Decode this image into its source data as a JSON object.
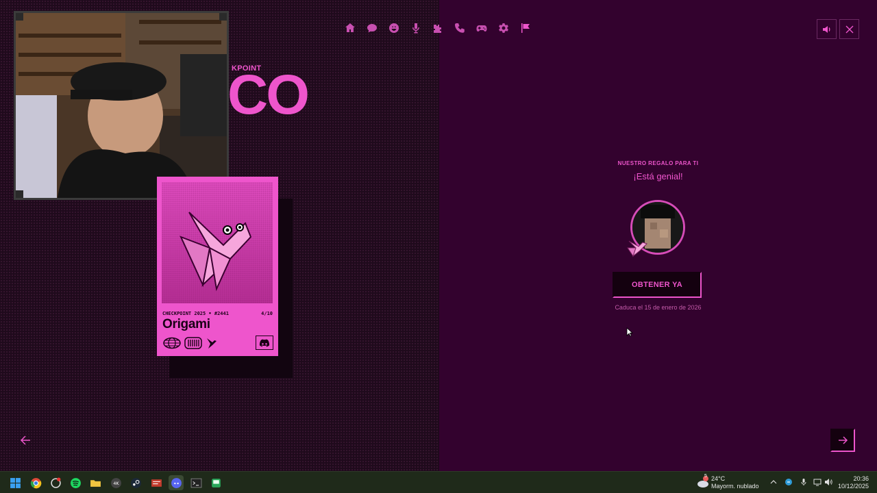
{
  "header": {
    "eyebrow": "KPOINT",
    "title_fragment": "CO"
  },
  "nav": {
    "icons": [
      "home-icon",
      "chat-bubble-icon",
      "smiley-icon",
      "microphone-icon",
      "puzzle-icon",
      "phone-icon",
      "gamepad-icon",
      "gear-icon",
      "flag-icon"
    ],
    "active_index": 8
  },
  "window_controls": {
    "sound": "speaker-icon",
    "close": "close-icon"
  },
  "card": {
    "series": "CHECKPOINT 2025 • #2441",
    "count": "4/10",
    "name": "Origami"
  },
  "gift": {
    "eyebrow": "NUESTRO REGALO PARA TI",
    "title": "¡Está genial!",
    "cta_label": "OBTENER YA",
    "expiry": "Caduca el 15 de enero de 2026"
  },
  "taskbar": {
    "weather_temp": "24°C",
    "weather_desc": "Mayorm. nublado",
    "weather_badge": "5",
    "time": "20:36",
    "date": "10/12/2025"
  },
  "colors": {
    "accent": "#ee55cc",
    "left_bg": "#1f0a1c",
    "right_bg": "#33022e"
  }
}
